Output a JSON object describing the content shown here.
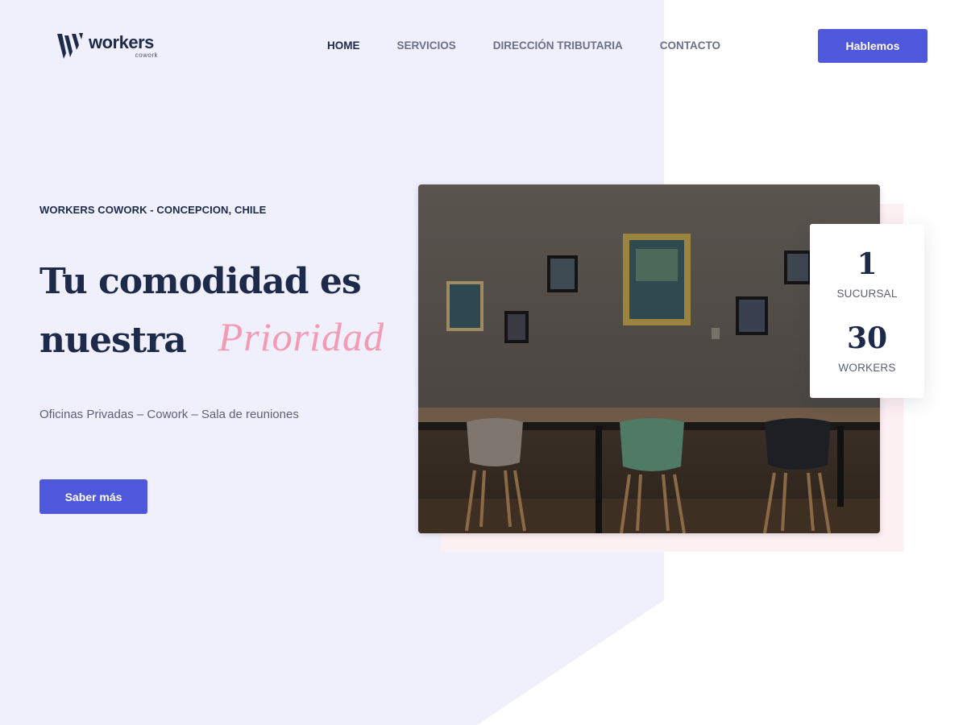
{
  "header": {
    "logo": {
      "name": "workers",
      "sub": "cowork"
    },
    "nav": [
      {
        "label": "HOME",
        "active": true
      },
      {
        "label": "SERVICIOS",
        "active": false
      },
      {
        "label": "DIRECCIÓN TRIBUTARIA",
        "active": false
      },
      {
        "label": "CONTACTO",
        "active": false
      }
    ],
    "cta_label": "Hablemos"
  },
  "hero": {
    "eyebrow": "WORKERS COWORK - CONCEPCION, CHILE",
    "headline_line1": "Tu comodidad es",
    "headline_line2": "nuestra",
    "headline_accent": "Prioridad",
    "subtext": "Oficinas Privadas – Cowork – Sala de reuniones",
    "button_label": "Saber más"
  },
  "stats": [
    {
      "number": "1",
      "label": "SUCURSAL"
    },
    {
      "number": "30",
      "label": "WORKERS"
    }
  ],
  "colors": {
    "primary": "#4f58db",
    "navy": "#1e2a4a",
    "accent_pink": "#f39ab4",
    "bg_lavender": "#f0f0fd",
    "photo_backdrop": "#fdf0f3"
  },
  "icons": {
    "logo": "workers-w-logo-icon"
  }
}
